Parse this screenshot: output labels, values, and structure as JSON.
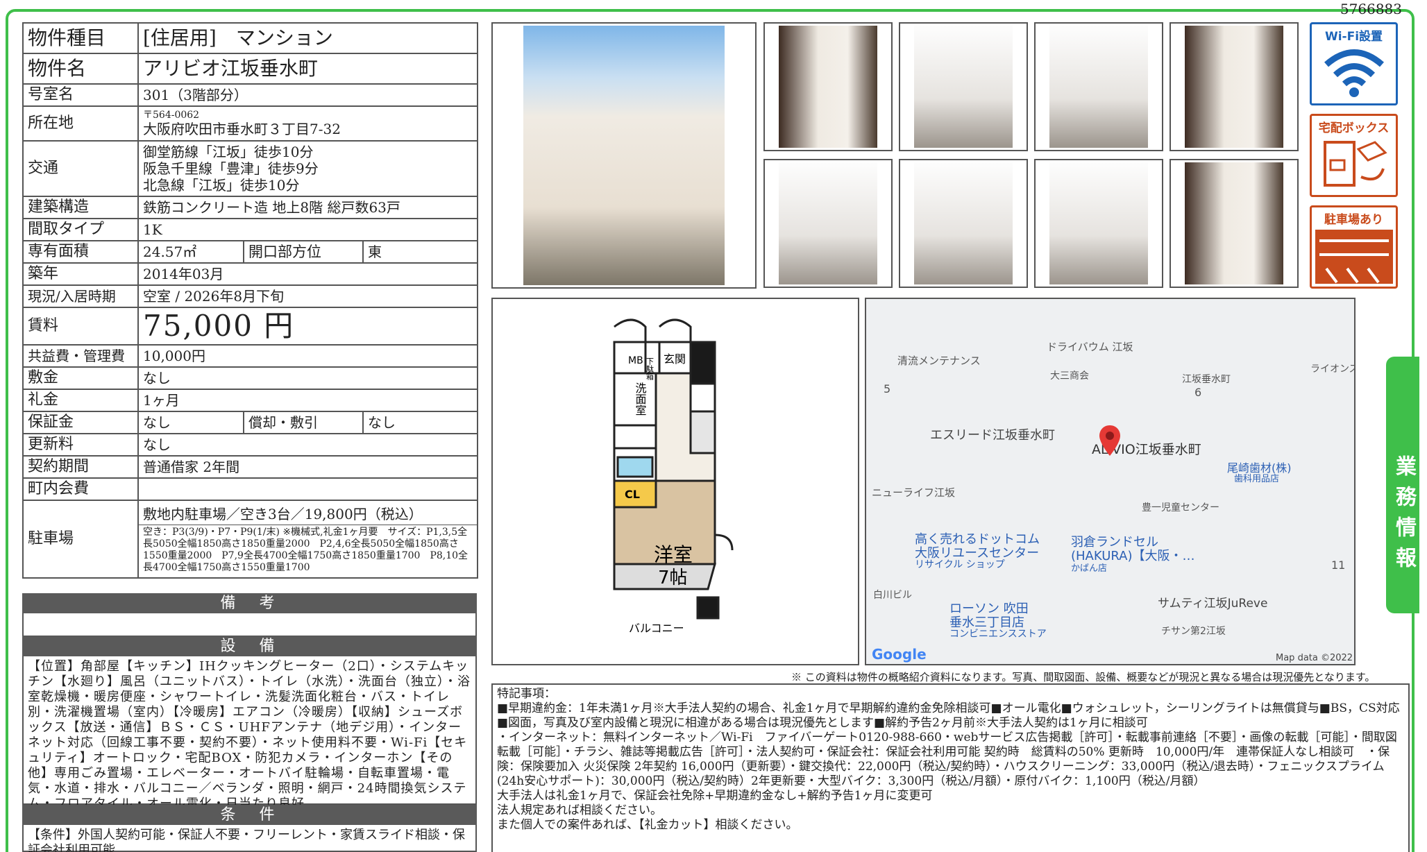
{
  "doc_number": "5766883",
  "property": {
    "type_label": "物件種目",
    "type_value": "[住居用]　マンション",
    "name_label": "物件名",
    "name_value": "アリビオ江坂垂水町",
    "room_label": "号室名",
    "room_value": "301（3階部分）",
    "address_label": "所在地",
    "postal": "〒564-0062",
    "address_value": "大阪府吹田市垂水町３丁目7-32",
    "transport_label": "交通",
    "transport": [
      "御堂筋線「江坂」徒歩10分",
      "阪急千里線「豊津」徒歩9分",
      "北急線「江坂」徒歩10分"
    ],
    "structure_label": "建築構造",
    "structure_value": "鉄筋コンクリート造 地上8階 総戸数63戸",
    "layout_label": "間取タイプ",
    "layout_value": "1K",
    "area_label": "専有面積",
    "area_value": "24.57㎡",
    "direction_label": "開口部方位",
    "direction_value": "東",
    "built_label": "築年",
    "built_value": "2014年03月",
    "status_label": "現況/入居時期",
    "status_value": "空室 / 2026年8月下旬",
    "rent_label": "賃料",
    "rent_value": "75,000 円",
    "fee_label": "共益費・管理費",
    "fee_value": "10,000円",
    "deposit_label": "敷金",
    "deposit_value": "なし",
    "key_money_label": "礼金",
    "key_money_value": "1ヶ月",
    "guarantee_label": "保証金",
    "guarantee_value": "なし",
    "amort_label": "償却・敷引",
    "amort_value": "なし",
    "renewal_label": "更新料",
    "renewal_value": "なし",
    "contract_label": "契約期間",
    "contract_value": "普通借家 2年間",
    "community_label": "町内会費",
    "community_value": "",
    "parking_label": "駐車場",
    "parking_value": "敷地内駐車場／空き3台／19,800円（税込）",
    "parking_detail": "空き：P3(3/9)・P7・P9(1/末) ※機械式,礼金1ヶ月要　サイズ：P1,3,5全長5050全幅1850高さ1850重量2000　P2,4,6全長5050全幅1850高さ1550重量2000　P7,9全長4700全幅1750高さ1850重量1700　P8,10全長4700全幅1750高さ1550重量1700"
  },
  "remarks_header": "備　考",
  "remarks_text": "",
  "equipment_header": "設　備",
  "equipment_text": "【位置】角部屋【キッチン】IHクッキングヒーター（2口）・システムキッチン【水廻り】風呂（ユニットバス）・トイレ（水洗）・洗面台（独立）・浴室乾燥機・暖房便座・シャワートイレ・洗髪洗面化粧台・バス・トイレ別・洗濯機置場（室内）【冷暖房】エアコン（冷暖房）【収納】シューズボックス【放送・通信】ＢＳ・ＣＳ・UHFアンテナ（地デジ用）・インターネット対応（回線工事不要・契約不要）・ネット使用料不要・Wi-Fi【セキュリティ】オートロック・宅配BOX・防犯カメラ・インターホン【その他】専用ごみ置場・エレベーター・オートバイ駐輪場・自転車置場・電気・水道・排水・バルコニー／ベランダ・照明・網戸・24時間換気システム・フロアタイル・オール電化・日当たり良好",
  "conditions_header": "条　件",
  "conditions_text": "【条件】外国人契約可能・保証人不要・フリーレント・家賃スライド相談・保証会社利用可能",
  "badges": {
    "wifi": "Wi-Fi設置",
    "delivery": "宅配ボックス",
    "parking": "駐車場あり"
  },
  "floorplan": {
    "mb": "MB",
    "shoes": "下駄箱",
    "entrance": "玄関",
    "washroom": "洗面室",
    "cl": "CL",
    "room": "洋室",
    "size": "7帖",
    "balcony": "バルコニー"
  },
  "map": {
    "labels": [
      "ドライバウム 江坂",
      "清流メンテナンス",
      "ライオンズマンション",
      "江坂垂水町",
      "大三商会",
      "5",
      "6",
      "エスリード江坂垂水町",
      "ALIVIO江坂垂水町",
      "尾崎歯材(株)",
      "歯科用品店",
      "ニューライフ江坂",
      "豊一児童センター",
      "高く売れるドットコム",
      "大阪リユースセンター",
      "リサイクル ショップ",
      "羽倉ランドセル",
      "(HAKURA)【大阪・…",
      "かばん店",
      "11",
      "白川ビル",
      "ローソン 吹田",
      "垂水三丁目店",
      "コンビニエンスストア",
      "サムティ江坂JuReve",
      "チサン第2江坂",
      "Google",
      "Map data ©2022"
    ]
  },
  "disclaimer": "※ この資料は物件の概略紹介資料になります。写真、間取図面、設備、概要などが現況と異なる場合は現況優先となります。",
  "special_notes": "特記事項：\n■早期違約金：1年未満1ヶ月※大手法人契約の場合、礼金1ヶ月で早期解約違約金免除相談可■オール電化■ウォシュレット，シーリングライトは無償貸与■BS，CS対応■図面，写真及び室内設備と現況に相違がある場合は現況優先とします■解約予告2ヶ月前※大手法人契約は1ヶ月に相談可\n・インターネット：無料インターネット／Wi-Fi　ファイバーゲート0120-988-660・webサービス広告掲載［許可］・転載事前連絡［不要］・画像の転載［可能］・間取図転載［可能］・チラシ、雑誌等掲載広告［許可］・法人契約可・保証会社：保証会社利用可能 契約時　総賃料の50% 更新時　10,000円/年　連帯保証人なし相談可　・保険：保険要加入 火災保険 2年契約 16,000円（更新要）・鍵交換代：22,000円（税込/契約時）・ハウスクリーニング：33,000円（税込/退去時）・フェニックスプライム(24h安心サポート)：30,000円（税込/契約時）2年更新要・大型バイク：3,300円（税込/月額）・原付バイク：1,100円（税込/月額）\n大手法人は礼金1ヶ月で、保証会社免除+早期違約金なし+解約予告1ヶ月に変更可\n法人規定あれば相談ください。\nまた個人での案件あれば、【礼金カット】相談ください。",
  "side_tab": "業務情報",
  "colors": {
    "accent_green": "#3fbf4a",
    "header_grey": "#5a5a5a",
    "badge_orange": "#c94b1c",
    "wifi_blue": "#1c64b8"
  }
}
